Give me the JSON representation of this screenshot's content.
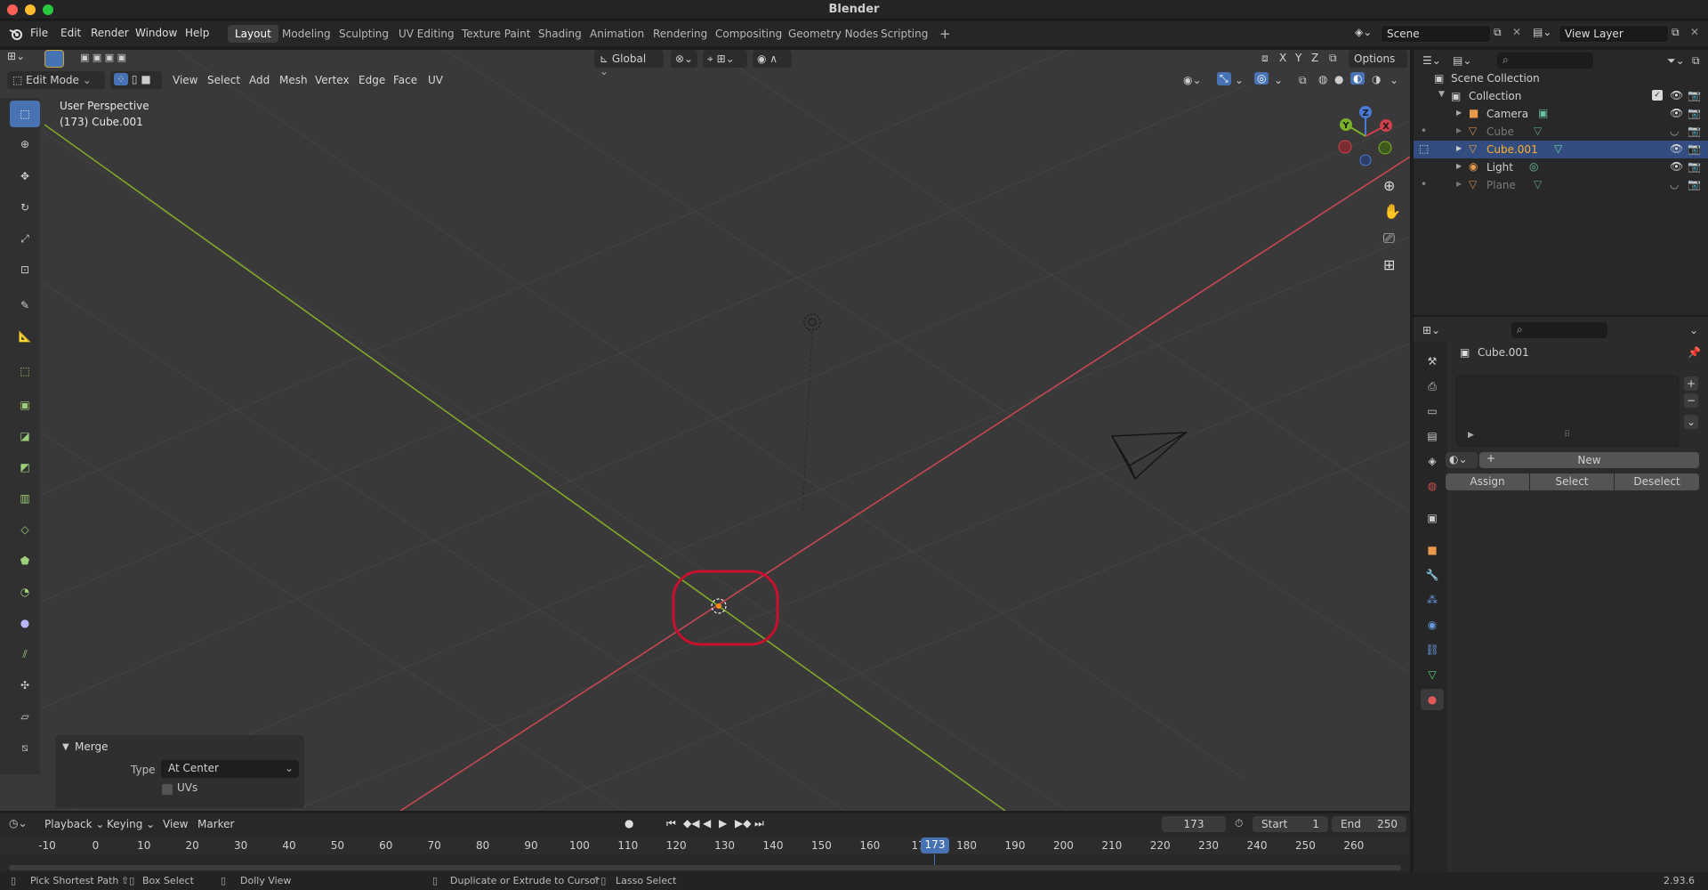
{
  "window": {
    "title": "Blender"
  },
  "menu": [
    "File",
    "Edit",
    "Render",
    "Window",
    "Help"
  ],
  "workspaces": [
    "Layout",
    "Modeling",
    "Sculpting",
    "UV Editing",
    "Texture Paint",
    "Shading",
    "Animation",
    "Rendering",
    "Compositing",
    "Geometry Nodes",
    "Scripting"
  ],
  "active_workspace": "Layout",
  "scene": {
    "name": "Scene",
    "view_layer": "View Layer"
  },
  "viewport": {
    "transform_orientation": "Global",
    "options_label": "Options",
    "axis_toggles": [
      "X",
      "Y",
      "Z"
    ],
    "mode": "Edit Mode",
    "header_menus": [
      "View",
      "Select",
      "Add",
      "Mesh",
      "Vertex",
      "Edge",
      "Face",
      "UV"
    ],
    "overlay_text": "User Perspective",
    "overlay_object": "(173) Cube.001",
    "gizmo_axes": [
      "X",
      "Y",
      "Z"
    ]
  },
  "operator_panel": {
    "title": "Merge",
    "type_label": "Type",
    "type_value": "At Center",
    "uvs_label": "UVs",
    "uvs_checked": false
  },
  "outliner": {
    "root": "Scene Collection",
    "collection": "Collection",
    "items": [
      {
        "name": "Camera",
        "icon": "camera-icon",
        "visible": true,
        "selected": false
      },
      {
        "name": "Cube",
        "icon": "mesh-icon",
        "visible": false,
        "selected": false
      },
      {
        "name": "Cube.001",
        "icon": "mesh-icon",
        "visible": true,
        "selected": true
      },
      {
        "name": "Light",
        "icon": "light-icon",
        "visible": true,
        "selected": false
      },
      {
        "name": "Plane",
        "icon": "mesh-icon",
        "visible": false,
        "selected": false
      }
    ]
  },
  "properties": {
    "object_name": "Cube.001",
    "new_label": "New",
    "assign_label": "Assign",
    "select_label": "Select",
    "deselect_label": "Deselect"
  },
  "timeline": {
    "menus": [
      "Playback",
      "Keying",
      "View",
      "Marker"
    ],
    "current_frame": "173",
    "start_label": "Start",
    "start_value": "1",
    "end_label": "End",
    "end_value": "250",
    "ruler": [
      "-10",
      "0",
      "10",
      "20",
      "30",
      "40",
      "50",
      "60",
      "70",
      "80",
      "90",
      "100",
      "110",
      "120",
      "130",
      "140",
      "150",
      "160",
      "17",
      "180",
      "190",
      "200",
      "210",
      "220",
      "230",
      "240",
      "250",
      "260"
    ],
    "playhead_label": "173"
  },
  "statusbar": {
    "hints": [
      "Pick Shortest Path",
      "Box Select",
      "Dolly View",
      "Duplicate or Extrude to Cursor",
      "Lasso Select"
    ],
    "version": "2.93.6"
  },
  "colors": {
    "accent": "#4772b3",
    "x_axis": "#c84654",
    "y_axis": "#80a82a",
    "highlight_ring": "#c8102e"
  }
}
